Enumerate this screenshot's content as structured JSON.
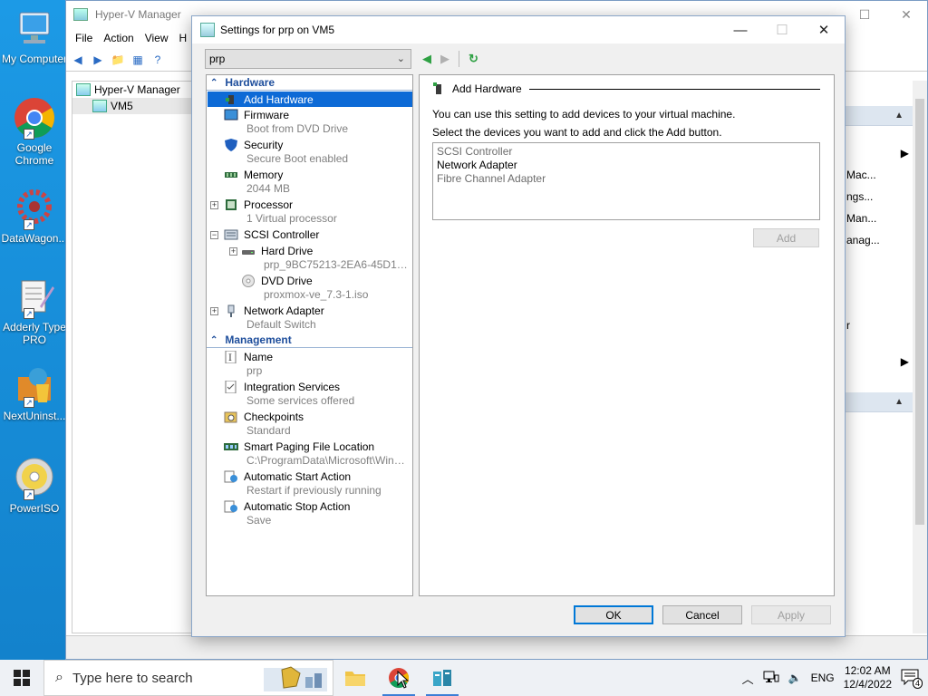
{
  "desktop": {
    "icons": [
      {
        "label": "My Computer",
        "name": "my-computer"
      },
      {
        "label": "Google Chrome",
        "name": "google-chrome"
      },
      {
        "label": "DataWagon...",
        "name": "datawagon"
      },
      {
        "label": "Adderly Type PRO",
        "name": "adderly-type-pro"
      },
      {
        "label": "NextUninst...",
        "name": "nextuninstaller"
      },
      {
        "label": "PowerISO",
        "name": "poweriso"
      }
    ]
  },
  "hyperv": {
    "title": "Hyper-V Manager",
    "menu": [
      "File",
      "Action",
      "View",
      "H"
    ],
    "tree": {
      "root": "Hyper-V Manager",
      "server": "VM5"
    },
    "actions": [
      "Mac...",
      "ngs...",
      "Man...",
      "anag...",
      "r"
    ]
  },
  "dialog": {
    "title": "Settings for prp on VM5",
    "vm_select": "prp",
    "sections": {
      "hardware": "Hardware",
      "management": "Management"
    },
    "hardware_items": [
      {
        "label": "Add Hardware",
        "sub": ""
      },
      {
        "label": "Firmware",
        "sub": "Boot from DVD Drive"
      },
      {
        "label": "Security",
        "sub": "Secure Boot enabled"
      },
      {
        "label": "Memory",
        "sub": "2044 MB"
      },
      {
        "label": "Processor",
        "sub": "1 Virtual processor"
      },
      {
        "label": "SCSI Controller",
        "sub": ""
      },
      {
        "label": "Hard Drive",
        "sub": "prp_9BC75213-2EA6-45D1-9C..."
      },
      {
        "label": "DVD Drive",
        "sub": "proxmox-ve_7.3-1.iso"
      },
      {
        "label": "Network Adapter",
        "sub": "Default Switch"
      }
    ],
    "management_items": [
      {
        "label": "Name",
        "sub": "prp"
      },
      {
        "label": "Integration Services",
        "sub": "Some services offered"
      },
      {
        "label": "Checkpoints",
        "sub": "Standard"
      },
      {
        "label": "Smart Paging File Location",
        "sub": "C:\\ProgramData\\Microsoft\\Windo..."
      },
      {
        "label": "Automatic Start Action",
        "sub": "Restart if previously running"
      },
      {
        "label": "Automatic Stop Action",
        "sub": "Save"
      }
    ],
    "pane": {
      "heading": "Add Hardware",
      "line1": "You can use this setting to add devices to your virtual machine.",
      "line2": "Select the devices you want to add and click the Add button.",
      "devices": [
        {
          "label": "SCSI Controller",
          "enabled": false
        },
        {
          "label": "Network Adapter",
          "enabled": true
        },
        {
          "label": "Fibre Channel Adapter",
          "enabled": false
        }
      ],
      "add_button": "Add"
    },
    "buttons": {
      "ok": "OK",
      "cancel": "Cancel",
      "apply": "Apply"
    }
  },
  "taskbar": {
    "search_placeholder": "Type here to search",
    "language": "ENG",
    "time": "12:02 AM",
    "date": "12/4/2022",
    "notification_count": "4"
  },
  "colors": {
    "selection": "#0d6ad6",
    "section_header": "#1e4e9c",
    "desktop": "#1c9ae6"
  }
}
